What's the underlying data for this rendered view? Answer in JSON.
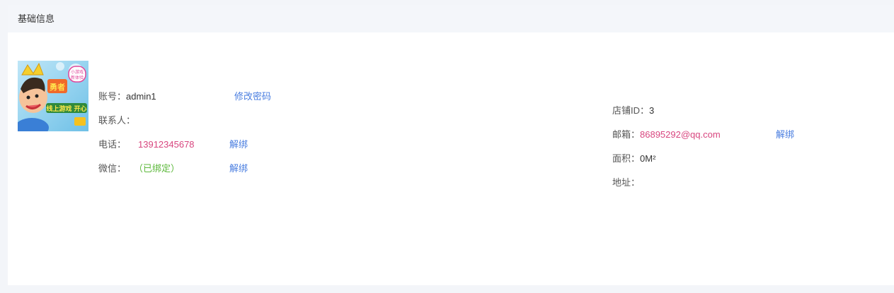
{
  "header": {
    "title": "基础信息"
  },
  "avatar": {
    "banner_text": "勇敢者",
    "sub_text_1": "线上游戏",
    "sub_text_2": "开心游戏",
    "badge_1": "小游戏",
    "badge_2": "新体验"
  },
  "account": {
    "label": "账号：",
    "value": "admin1",
    "action": "修改密码"
  },
  "contact": {
    "label": "联系人：",
    "value": ""
  },
  "phone": {
    "label": "电话：",
    "value": "13912345678",
    "action": "解绑"
  },
  "wechat": {
    "label": "微信：",
    "value": "（已绑定）",
    "action": "解绑"
  },
  "store": {
    "label": "店铺ID：",
    "value": "3"
  },
  "email": {
    "label": "邮箱：",
    "value": "86895292@qq.com",
    "action": "解绑"
  },
  "area": {
    "label": "面积：",
    "value": "0M²"
  },
  "address": {
    "label": "地址：",
    "value": ""
  },
  "colors": {
    "link": "#4a7ee0",
    "highlight": "#d8467f",
    "bound": "#5cb83a",
    "header_bg": "#f4f6fa",
    "page_bg": "#f3f5f9"
  }
}
